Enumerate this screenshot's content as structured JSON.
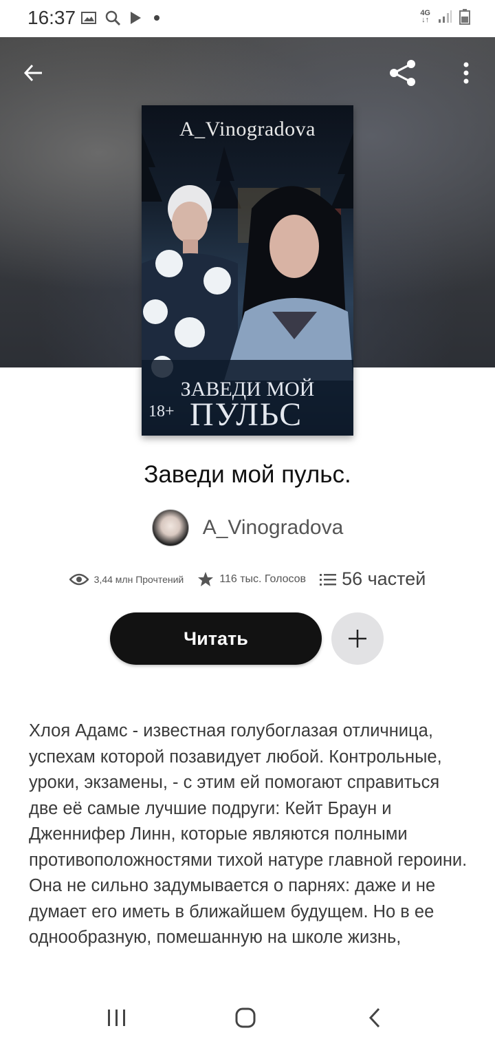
{
  "status_bar": {
    "time": "16:37",
    "left_icons": [
      "gallery-icon",
      "search-icon",
      "play-icon",
      "dot-icon"
    ],
    "network": "4G",
    "right_icons": [
      "signal-icon",
      "battery-icon"
    ]
  },
  "header": {
    "back_icon": "arrow-left-icon",
    "share_icon": "share-icon",
    "menu_icon": "more-vertical-icon"
  },
  "cover": {
    "author": "A_Vinogradova",
    "title_line1": "ЗАВЕДИ МОЙ",
    "age": "18+",
    "title_line2": "ПУЛЬС"
  },
  "book": {
    "title": "Заведи мой пульс.",
    "author": "A_Vinogradova"
  },
  "stats": {
    "reads": "3,44 млн Прочтений",
    "votes": "116 тыс. Голосов",
    "parts": "56 частей"
  },
  "actions": {
    "read_label": "Читать",
    "add_icon": "plus-icon"
  },
  "description": [
    "Хлоя Адамс - известная голубоглазая отличница, успехам которой позавидует любой. Контрольные, уроки, экзамены, - с этим ей помогают справиться две её самые лучшие подруги: Кейт Браун и Дженнифер Линн, которые являются полными противоположностями тихой натуре главной героини.",
    "Она не сильно задумывается о парнях: даже и не думает его иметь в ближайшем будущем. Но в ее однообразную, помешанную на школе жизнь,"
  ],
  "navbar": {
    "icons": [
      "recents-icon",
      "home-icon",
      "back-icon"
    ]
  }
}
